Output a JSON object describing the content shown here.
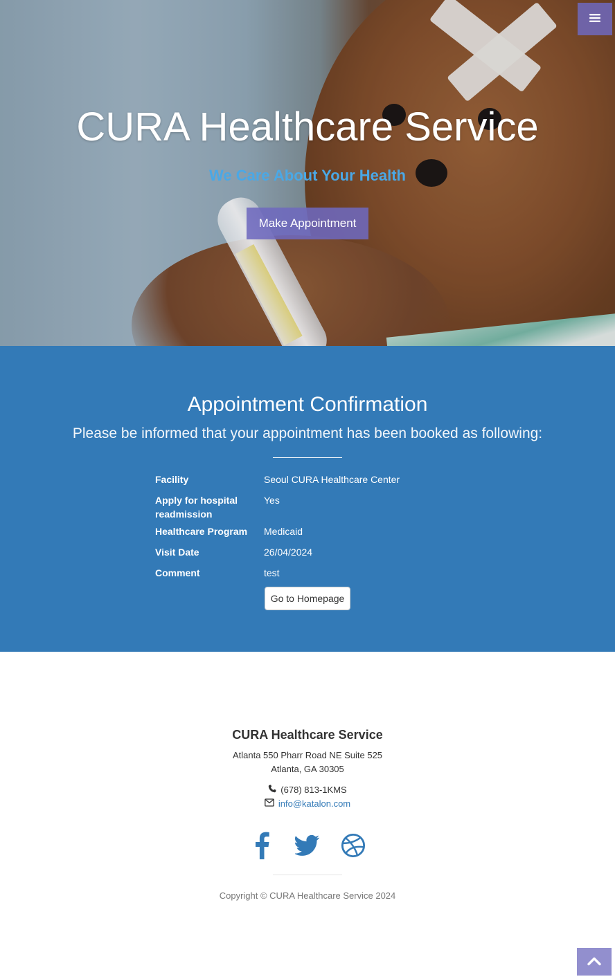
{
  "colors": {
    "accent": "#6e69be",
    "section_bg": "#337ab7",
    "subtitle": "#4aa8e6",
    "link": "#337ab7"
  },
  "header": {
    "menu_icon": "hamburger-menu-icon"
  },
  "hero": {
    "title": "CURA Healthcare Service",
    "subtitle": "We Care About Your Health",
    "make_appointment_label": "Make Appointment"
  },
  "confirmation": {
    "heading": "Appointment Confirmation",
    "lead": "Please be informed that your appointment has been booked as following:",
    "rows": [
      {
        "label": "Facility",
        "value": "Seoul CURA Healthcare Center"
      },
      {
        "label": "Apply for hospital readmission",
        "value": "Yes"
      },
      {
        "label": "Healthcare Program",
        "value": "Medicaid"
      },
      {
        "label": "Visit Date",
        "value": "26/04/2024"
      },
      {
        "label": "Comment",
        "value": "test"
      }
    ],
    "homepage_button_label": "Go to Homepage"
  },
  "footer": {
    "title": "CURA Healthcare Service",
    "address_line1": "Atlanta 550 Pharr Road NE Suite 525",
    "address_line2": "Atlanta, GA 30305",
    "phone": "(678) 813-1KMS",
    "email": "info@katalon.com",
    "social_icons": [
      "facebook-icon",
      "twitter-icon",
      "dribbble-icon"
    ],
    "copyright": "Copyright © CURA Healthcare Service 2024"
  },
  "scroll_top_icon": "chevron-up-icon"
}
